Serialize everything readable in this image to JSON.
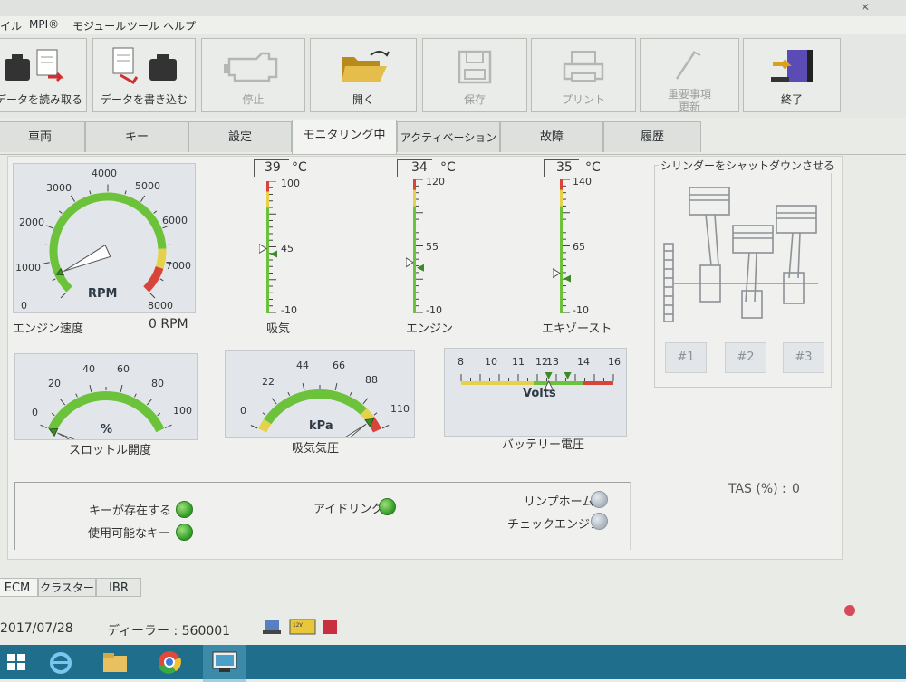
{
  "menu": [
    "イル",
    "MPI®",
    "モジュール",
    "ツール",
    "ヘルプ"
  ],
  "toolbar": {
    "read": "データを読み取る",
    "write": "データを書き込む",
    "stop": "停止",
    "open": "開く",
    "save": "保存",
    "print": "プリント",
    "update_line1": "重要事項",
    "update_line2": "更新",
    "exit": "終了"
  },
  "tabs": [
    "車両",
    "キー",
    "設定",
    "モニタリング中",
    "アクティベーション",
    "故障",
    "履歴"
  ],
  "engine_speed": {
    "label": "エンジン速度",
    "readout": "0 RPM",
    "unit": "RPM",
    "ticks": [
      "0",
      "1000",
      "2000",
      "3000",
      "4000",
      "5000",
      "6000",
      "7000",
      "8000"
    ],
    "value": 0,
    "needle_value": 0.6
  },
  "temps": [
    {
      "name": "吸気",
      "value": "39",
      "unit": "°C",
      "max": "100",
      "mid": "45",
      "min": "-10",
      "fraction": 0.49
    },
    {
      "name": "エンジン",
      "value": "34",
      "unit": "°C",
      "max": "120",
      "mid": "55",
      "min": "-10",
      "fraction": 0.38
    },
    {
      "name": "エキゾースト",
      "value": "35",
      "unit": "°C",
      "max": "140",
      "mid": "65",
      "min": "-10",
      "fraction": 0.3
    }
  ],
  "throttle": {
    "label": "スロットル開度",
    "unit": "%",
    "ticks": [
      "0",
      "20",
      "40",
      "60",
      "80",
      "100"
    ],
    "value": 0
  },
  "map": {
    "label": "吸気気圧",
    "unit": "kPa",
    "ticks": [
      "0",
      "22",
      "44",
      "66",
      "88",
      "110"
    ],
    "value": 101
  },
  "battery": {
    "label": "バッテリー電圧",
    "unit": "Volts",
    "ticks": [
      "8",
      "10",
      "11",
      "12",
      "13",
      "14",
      "16"
    ],
    "value": 12.6
  },
  "cylinders": {
    "title": "シリンダーをシャットダウンさせる",
    "buttons": [
      "#1",
      "#2",
      "#3"
    ]
  },
  "indicators": [
    {
      "label": "キーが存在する",
      "state": "on"
    },
    {
      "label": "使用可能なキー",
      "state": "on"
    },
    {
      "label": "アイドリング",
      "state": "on"
    },
    {
      "label": "リンプホーム",
      "state": "off"
    },
    {
      "label": "チェックエンジン",
      "state": "off"
    }
  ],
  "tas": {
    "label": "TAS (%) :",
    "value": "0"
  },
  "bottom_tabs": [
    "ECM",
    "クラスター",
    "IBR"
  ],
  "status": {
    "date": "2017/07/28",
    "dealer": "ディーラー : 560001"
  },
  "colors": {
    "green": "#6cc23a",
    "yellow": "#e5d24a",
    "red": "#d9443a",
    "panel": "#e2e6ea",
    "taskbar": "#1f6e8c"
  }
}
